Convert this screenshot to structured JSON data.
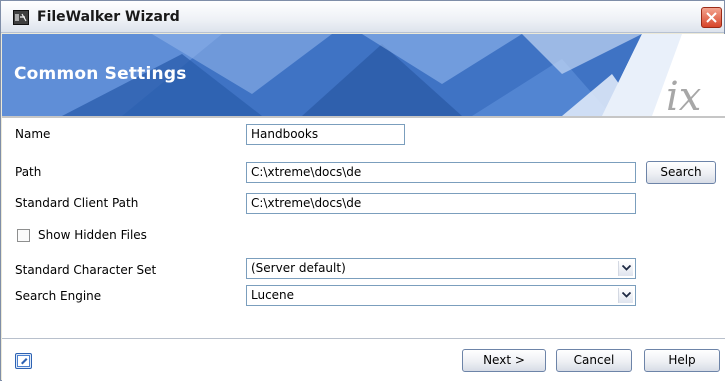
{
  "window": {
    "title": "FileWalker Wizard"
  },
  "banner": {
    "title": "Common Settings",
    "logo_text": "ix"
  },
  "form": {
    "name_label": "Name",
    "name_value": "Handbooks",
    "path_label": "Path",
    "path_value": "C:\\xtreme\\docs\\de",
    "search_button": "Search",
    "client_path_label": "Standard Client Path",
    "client_path_value": "C:\\xtreme\\docs\\de",
    "show_hidden_label": "Show Hidden Files",
    "show_hidden_checked": false,
    "charset_label": "Standard Character Set",
    "charset_value": "(Server default)",
    "engine_label": "Search Engine",
    "engine_value": "Lucene"
  },
  "footer": {
    "next_button": "Next >",
    "cancel_button": "Cancel",
    "help_button": "Help"
  },
  "icons": {
    "app": "app-icon",
    "close": "close-icon",
    "dropdown": "chevron-down-icon",
    "help": "help-icon"
  },
  "colors": {
    "banner_blue": "#4a7cc8",
    "close_red": "#d7452a",
    "field_border": "#7b9ebd"
  }
}
